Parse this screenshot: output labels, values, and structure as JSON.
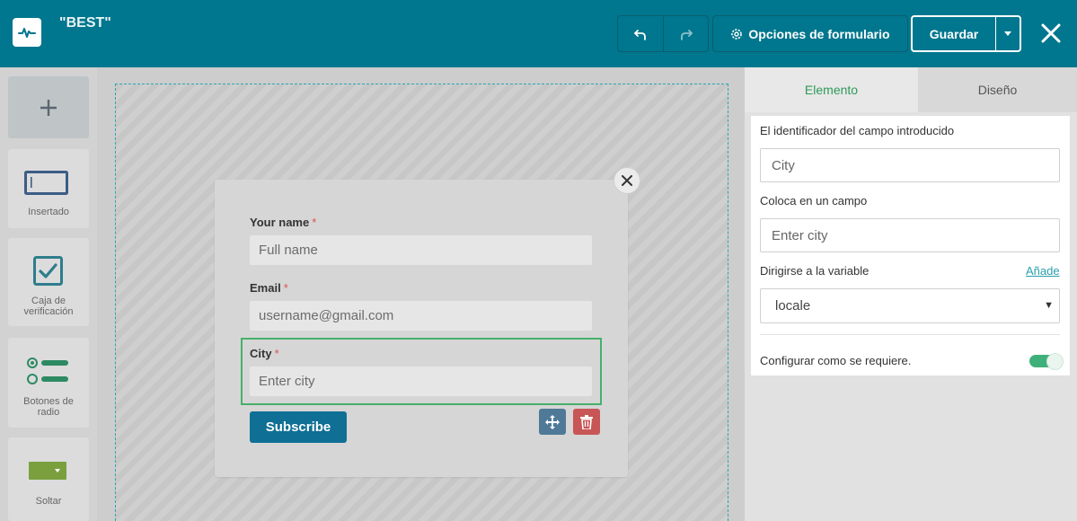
{
  "header": {
    "form_title": "\"BEST\"",
    "form_options_label": "Opciones de formulario",
    "save_label": "Guardar"
  },
  "sidebar": {
    "items": [
      {
        "label": "Insertado",
        "icon": "embedded-form-icon"
      },
      {
        "label": "Caja de verificación",
        "icon": "checkbox-icon"
      },
      {
        "label": "Botones de radio",
        "icon": "radio-buttons-icon"
      },
      {
        "label": "Soltar",
        "icon": "dropdown-icon"
      }
    ]
  },
  "form": {
    "fields": [
      {
        "label": "Your name",
        "required_mark": "*",
        "placeholder": "Full name"
      },
      {
        "label": "Email",
        "required_mark": "*",
        "placeholder": "username@gmail.com"
      },
      {
        "label": "City",
        "required_mark": "*",
        "placeholder": "Enter city"
      }
    ],
    "submit_label": "Subscribe"
  },
  "panel": {
    "tabs": [
      {
        "label": "Elemento",
        "active": true
      },
      {
        "label": "Diseño",
        "active": false
      }
    ],
    "field_id_label": "El identificador del campo introducido",
    "field_id_value": "City",
    "placeholder_label": "Coloca en un campo",
    "placeholder_value": "Enter city",
    "variable_label": "Dirigirse a la variable",
    "add_link": "Añade",
    "variable_value": "locale",
    "required_label": "Configurar como se requiere.",
    "required_on": true
  },
  "colors": {
    "header": "#00778e",
    "accent_green": "#3fb07a",
    "submit": "#0f6f95",
    "delete": "#c85656",
    "move": "#4f7997"
  }
}
